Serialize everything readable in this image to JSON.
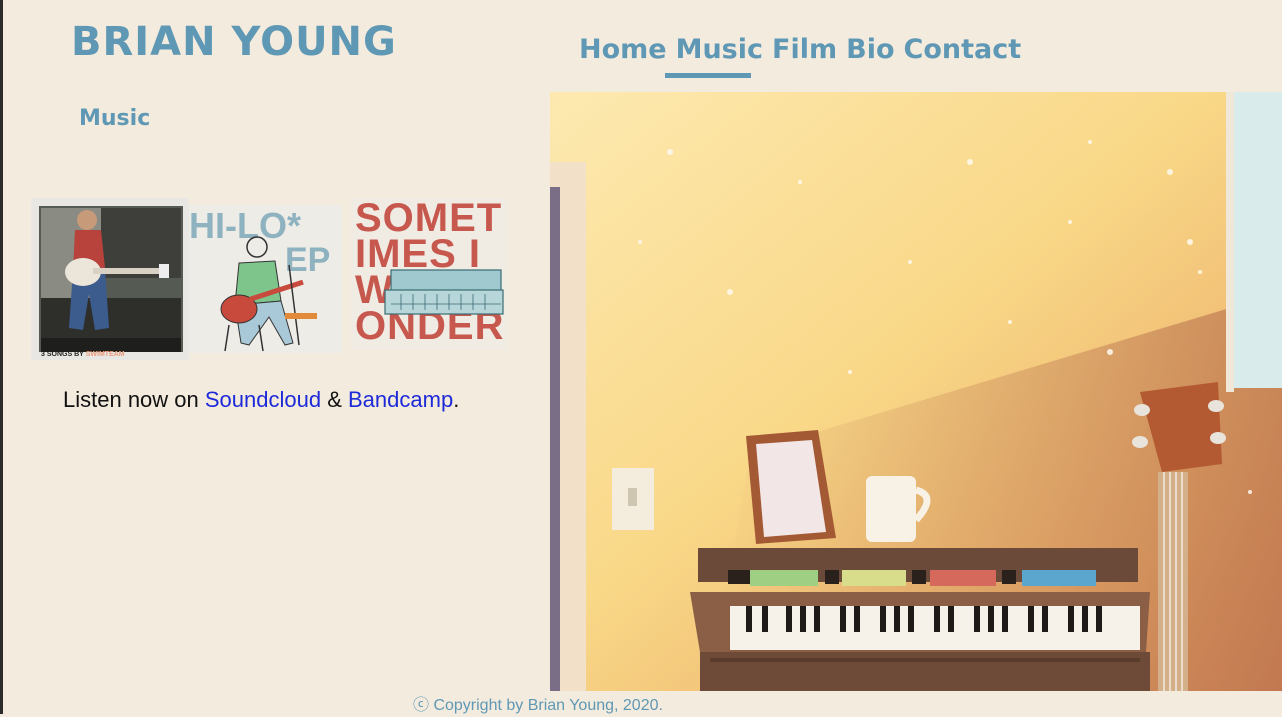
{
  "site": {
    "title": "BRIAN YOUNG"
  },
  "nav": {
    "items": [
      "Home",
      "Music",
      "Film",
      "Bio",
      "Contact"
    ],
    "active": "Music"
  },
  "section": {
    "title": "Music"
  },
  "albums": [
    {
      "name": "3 songs cover",
      "caption_prefix": "3 SONGS BY",
      "caption_artist": "SWIMTEAM"
    },
    {
      "name": "Hi-Lo EP cover",
      "title_line1": "HI-LO*",
      "title_line2": "EP"
    },
    {
      "name": "Sometimes I Wonder cover",
      "title_lines": [
        "SOMET",
        "IMES I",
        "W",
        "ONDER"
      ]
    }
  ],
  "listen": {
    "prefix": "Listen now on ",
    "link1": "Soundcloud",
    "conjunction": " & ",
    "link2": "Bandcamp",
    "suffix": "."
  },
  "hero": {
    "name": "piano illustration"
  },
  "footer": {
    "text": "ⓒ Copyright by Brian Young, 2020."
  },
  "colors": {
    "accent": "#5f98b4",
    "background": "#f4ebdf",
    "link": "#1d2ad8"
  }
}
